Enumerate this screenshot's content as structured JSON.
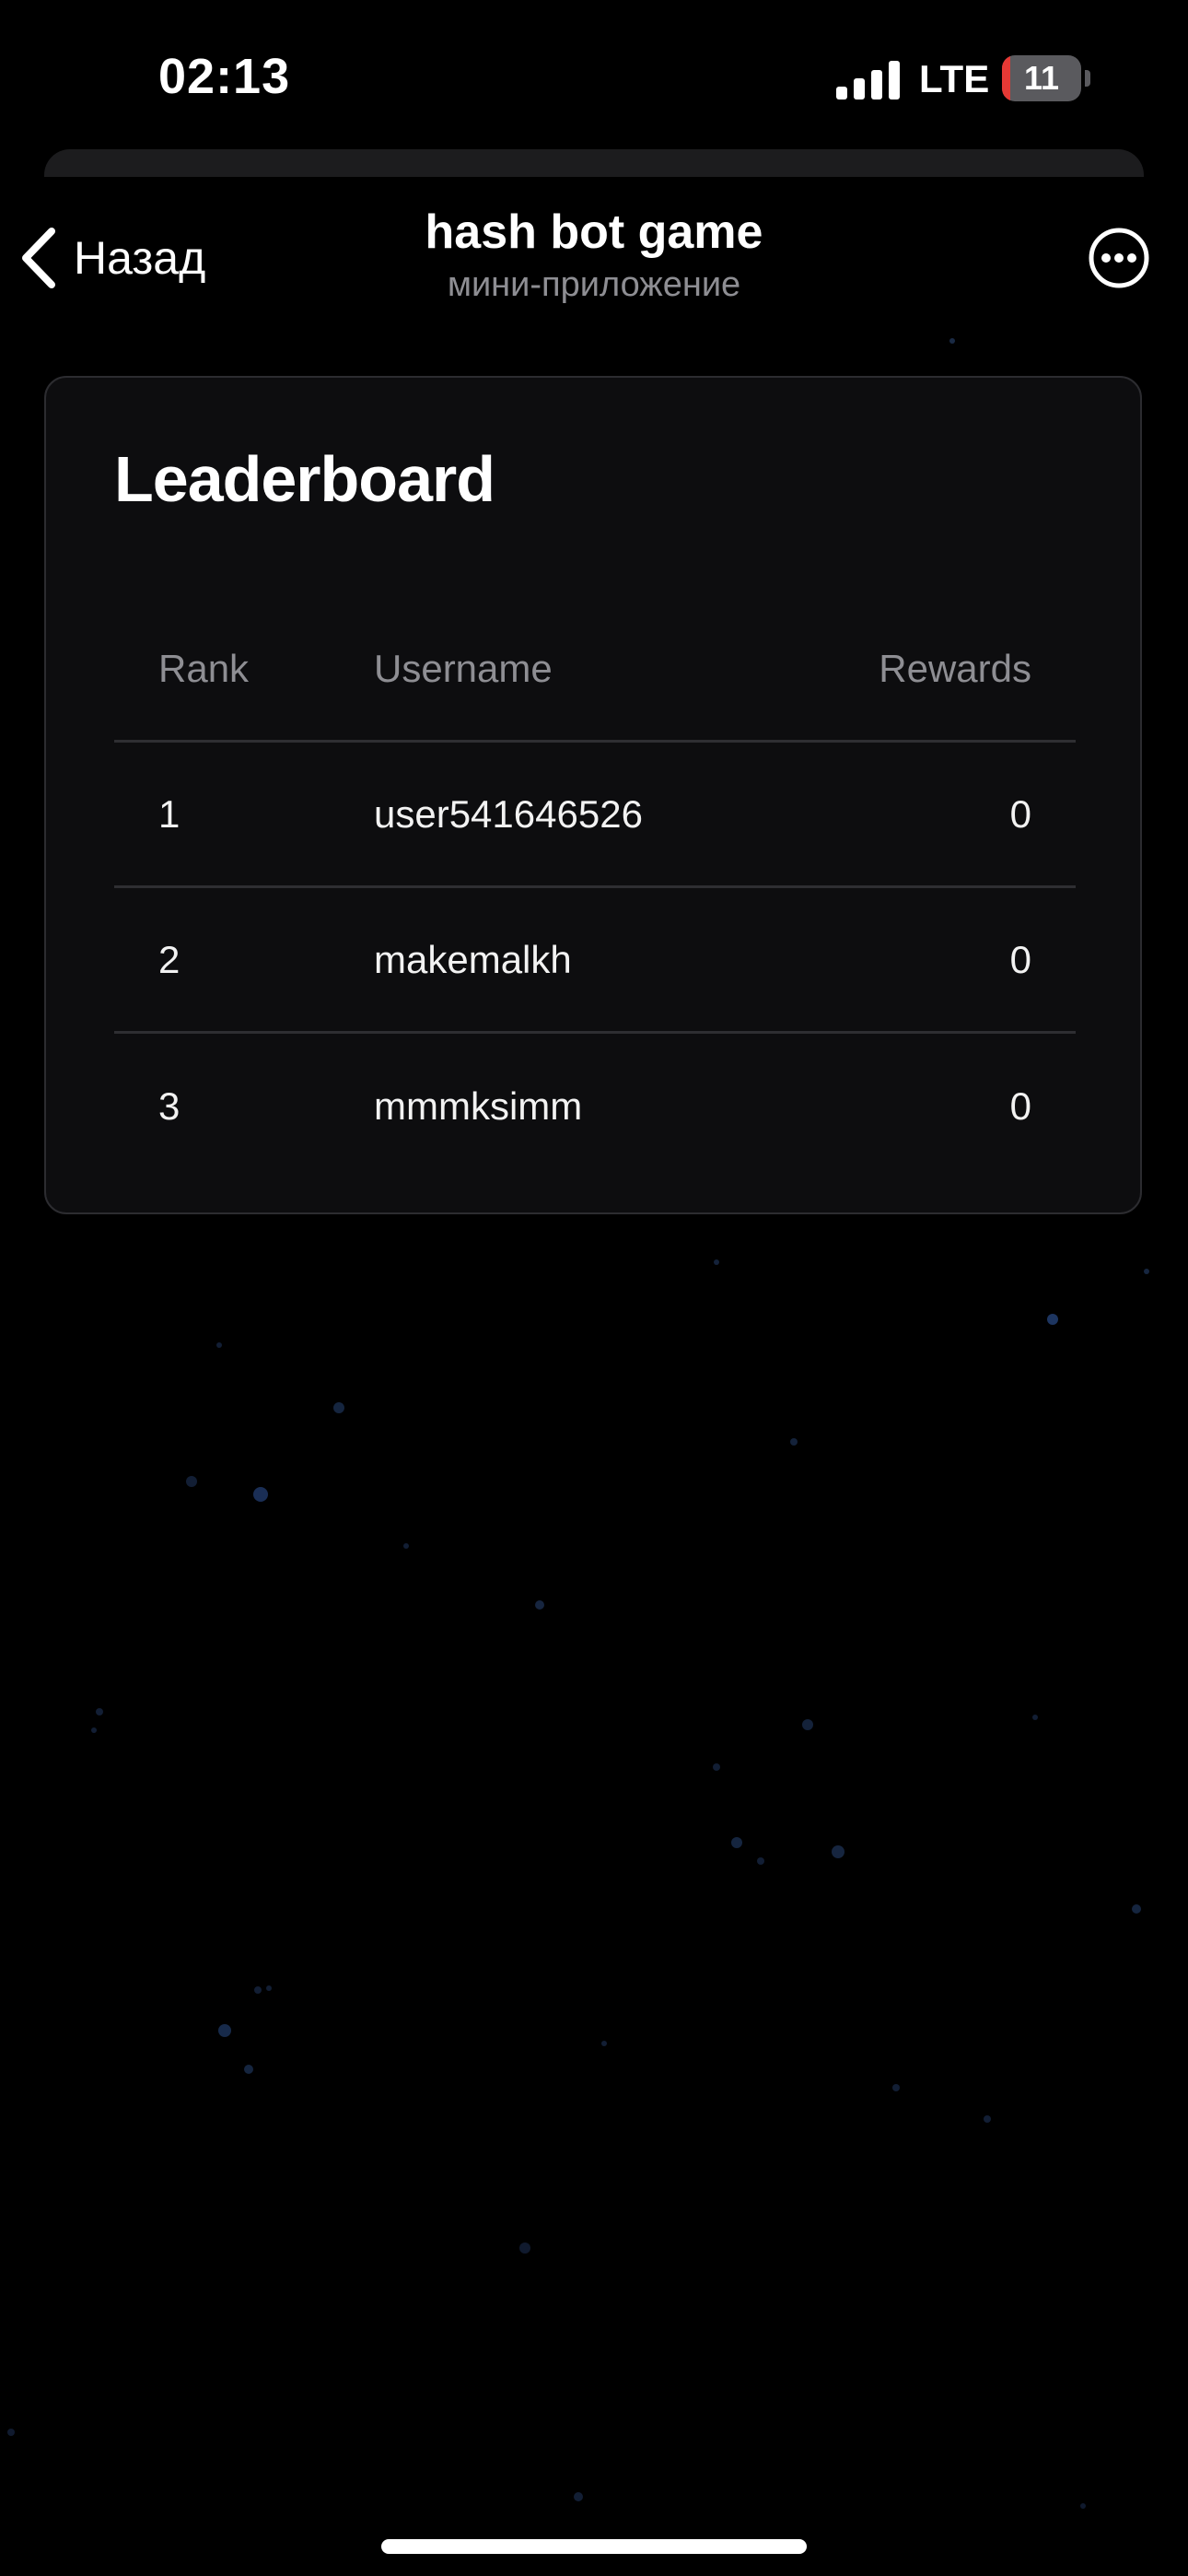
{
  "status_bar": {
    "time": "02:13",
    "network": "LTE",
    "battery_level": "11",
    "battery_color": "#e53935"
  },
  "nav": {
    "back_label": "Назад",
    "title": "hash bot game",
    "subtitle": "мини-приложение",
    "back_icon": "chevron-left-icon",
    "more_icon": "more-horizontal-circle-icon"
  },
  "leaderboard": {
    "title": "Leaderboard",
    "columns": {
      "rank": "Rank",
      "username": "Username",
      "rewards": "Rewards"
    },
    "rows": [
      {
        "rank": "1",
        "username": "user541646526",
        "rewards": "0"
      },
      {
        "rank": "2",
        "username": "makemalkh",
        "rewards": "0"
      },
      {
        "rank": "3",
        "username": "mmmksimm",
        "rewards": "0"
      }
    ]
  },
  "colors": {
    "background": "#000000",
    "card_background": "#0d0d0f",
    "muted_text": "#8e8e93",
    "divider": "#2e2e32"
  }
}
